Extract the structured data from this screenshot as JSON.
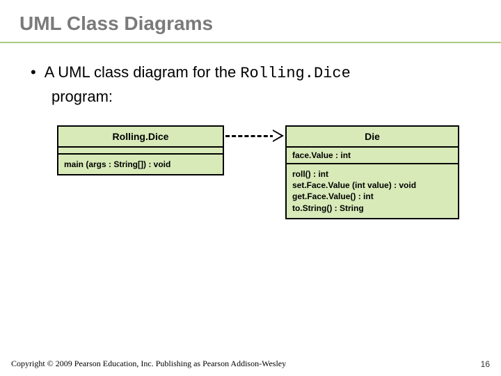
{
  "title": "UML Class Diagrams",
  "bullet": {
    "prefix": "A UML class diagram for the ",
    "code": "Rolling.Dice",
    "suffix": " program:"
  },
  "left_class": {
    "name": "Rolling.Dice",
    "attrs": "",
    "ops": [
      "main (args : String[]) : void"
    ]
  },
  "right_class": {
    "name": "Die",
    "attrs": "face.Value : int",
    "ops": [
      "roll() : int",
      "set.Face.Value (int value) : void",
      "get.Face.Value() : int",
      "to.String() : String"
    ]
  },
  "footer": {
    "copyright": "Copyright © 2009 Pearson Education, Inc. Publishing as Pearson Addison-Wesley",
    "page": "16"
  }
}
